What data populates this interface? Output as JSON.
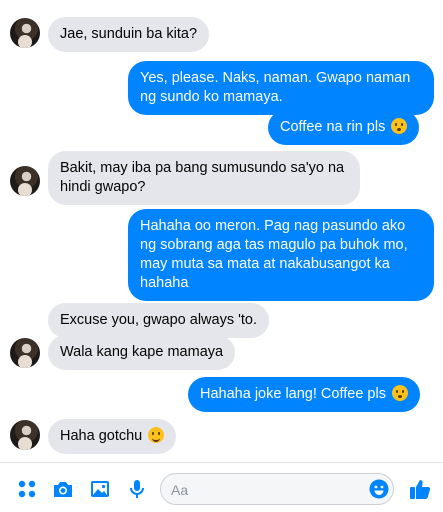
{
  "messages": [
    {
      "direction": "in",
      "text": "Jae, sunduin ba kita?"
    },
    {
      "direction": "out",
      "text": "Yes, please. Naks, naman. Gwapo naman\nng sundo ko mamaya."
    },
    {
      "direction": "out",
      "text": "Coffee na rin pls",
      "emoji": "kissing-face-icon"
    },
    {
      "direction": "in",
      "text": "Bakit, may iba pa bang sumusundo sa'yo na\nhindi gwapo?"
    },
    {
      "direction": "out",
      "text": "Hahaha oo meron. Pag nag pasundo ako\nng sobrang aga tas magulo pa buhok mo,\nmay muta sa mata at nakabusangot ka\nhahaha"
    },
    {
      "direction": "in",
      "text": "Excuse you, gwapo always 'to."
    },
    {
      "direction": "in",
      "text": "Wala kang kape mamaya"
    },
    {
      "direction": "out",
      "text": "Hahaha joke lang! Coffee pls",
      "emoji": "kissing-face-icon"
    },
    {
      "direction": "in",
      "text": "Haha gotchu",
      "emoji": "winking-face-icon"
    }
  ],
  "composer": {
    "placeholder": "Aa",
    "icons": [
      "more-icon",
      "camera-icon",
      "gallery-icon",
      "microphone-icon",
      "emoji-icon",
      "like-icon"
    ]
  },
  "colors": {
    "outgoing_bubble": "#0084ff",
    "incoming_bubble": "#e4e6eb",
    "accent": "#0084ff"
  }
}
